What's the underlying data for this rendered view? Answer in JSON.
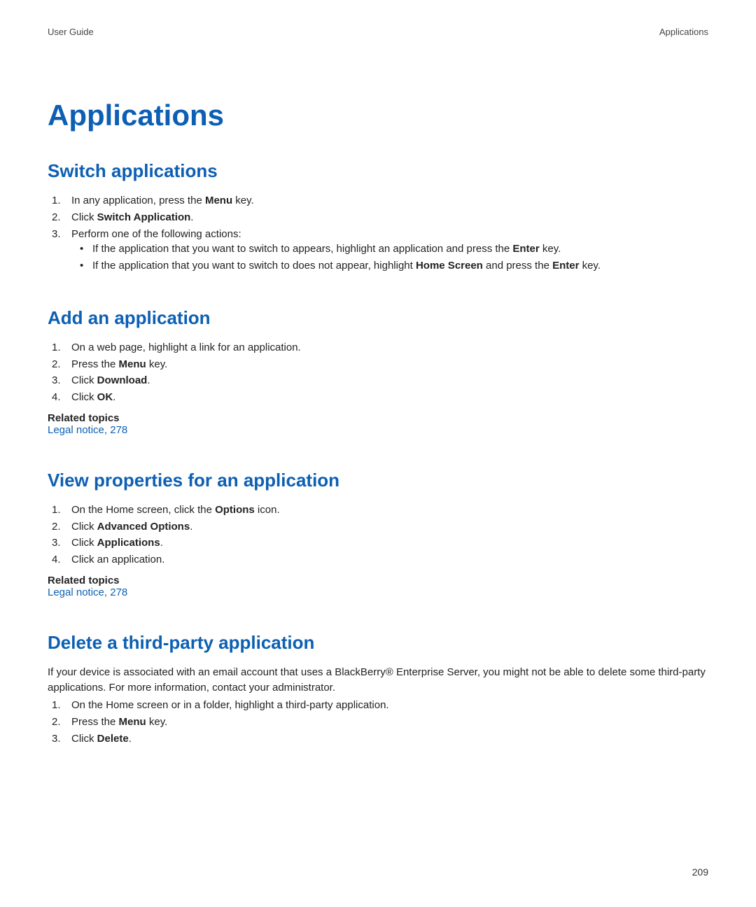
{
  "header": {
    "left": "User Guide",
    "right": "Applications"
  },
  "page_title": "Applications",
  "sections": [
    {
      "heading": "Switch applications",
      "steps": [
        {
          "pre": "In any application, press the ",
          "bold": "Menu",
          "post": " key."
        },
        {
          "pre": "Click ",
          "bold": "Switch Application",
          "post": "."
        },
        {
          "pre": "Perform one of the following actions:",
          "bold": "",
          "post": ""
        }
      ],
      "sub": [
        {
          "pre": "If the application that you want to switch to appears, highlight an application and press the ",
          "bold": "Enter",
          "post": " key."
        },
        {
          "pre": "If the application that you want to switch to does not appear, highlight ",
          "bold": "Home Screen",
          "mid": " and press the ",
          "bold2": "Enter",
          "post": " key."
        }
      ]
    },
    {
      "heading": "Add an application",
      "steps": [
        {
          "pre": "On a web page, highlight a link for an application.",
          "bold": "",
          "post": ""
        },
        {
          "pre": "Press the ",
          "bold": "Menu",
          "post": " key."
        },
        {
          "pre": "Click ",
          "bold": "Download",
          "post": "."
        },
        {
          "pre": "Click ",
          "bold": "OK",
          "post": "."
        }
      ],
      "related_label": "Related topics",
      "related_link": "Legal notice, 278"
    },
    {
      "heading": "View properties for an application",
      "steps": [
        {
          "pre": "On the Home screen, click the ",
          "bold": "Options",
          "post": " icon."
        },
        {
          "pre": "Click ",
          "bold": "Advanced Options",
          "post": "."
        },
        {
          "pre": "Click ",
          "bold": "Applications",
          "post": "."
        },
        {
          "pre": "Click an application.",
          "bold": "",
          "post": ""
        }
      ],
      "related_label": "Related topics",
      "related_link": "Legal notice, 278"
    },
    {
      "heading": "Delete a third-party application",
      "intro": "If your device is associated with an email account that uses a BlackBerry® Enterprise Server, you might not be able to delete some third-party applications. For more information, contact your administrator.",
      "steps": [
        {
          "pre": "On the Home screen or in a folder, highlight a third-party application.",
          "bold": "",
          "post": ""
        },
        {
          "pre": "Press the ",
          "bold": "Menu",
          "post": " key."
        },
        {
          "pre": "Click ",
          "bold": "Delete",
          "post": "."
        }
      ]
    }
  ],
  "page_number": "209"
}
